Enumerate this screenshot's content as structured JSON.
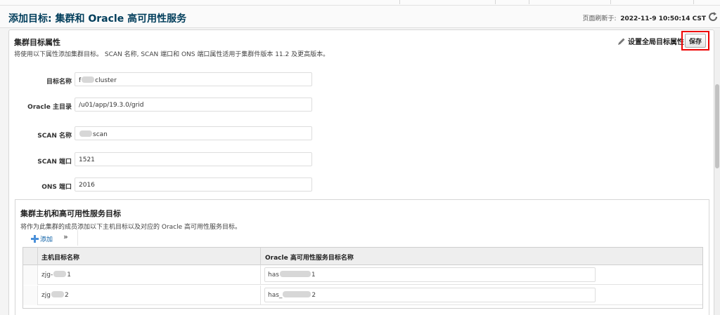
{
  "page": {
    "title": "添加目标: 集群和 Oracle 高可用性服务",
    "refresh_label": "页面刷新于:",
    "refresh_time": "2022-11-9 10:50:14 CST"
  },
  "section": {
    "title": "集群目标属性",
    "description": "将使用以下属性添加集群目标。 SCAN 名称, SCAN 端口和 ONS 端口属性适用于集群件版本 11.2 及更高版本。",
    "global_props_label": "设置全局目标属性",
    "save_label": "保存"
  },
  "fields": [
    {
      "label": "目标名称",
      "value_prefix": "f",
      "value_suffix": "cluster"
    },
    {
      "label": "Oracle 主目录",
      "value": "/u01/app/19.3.0/grid"
    },
    {
      "label": "SCAN 名称",
      "value_prefix": "",
      "value_suffix": "scan"
    },
    {
      "label": "SCAN 端口",
      "value": "1521"
    },
    {
      "label": "ONS 端口",
      "value": "2016"
    }
  ],
  "members": {
    "title": "集群主机和高可用性服务目标",
    "description": "将作为此集群的成员添加以下主机目标以及对应的 Oracle 高可用性服务目标。",
    "add_label": "添加",
    "expand_label": "»",
    "columns": [
      "主机目标名称",
      "Oracle 高可用性服务目标名称"
    ],
    "rows": [
      {
        "host_prefix": "zjg-",
        "host_suffix": "1",
        "has_prefix": "has",
        "has_suffix": "1"
      },
      {
        "host_prefix": "zjg",
        "host_suffix": "2",
        "has_prefix": "has_",
        "has_suffix": "2"
      }
    ]
  }
}
